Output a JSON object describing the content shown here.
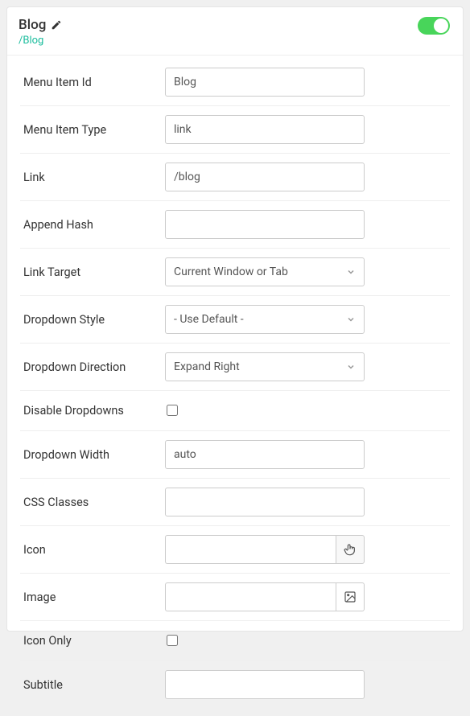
{
  "header": {
    "title": "Blog",
    "path": "/Blog",
    "enabled": true
  },
  "fields": {
    "menu_item_id": {
      "label": "Menu Item Id",
      "value": "Blog"
    },
    "menu_item_type": {
      "label": "Menu Item Type",
      "value": "link"
    },
    "link": {
      "label": "Link",
      "value": "/blog"
    },
    "append_hash": {
      "label": "Append Hash",
      "value": ""
    },
    "link_target": {
      "label": "Link Target",
      "value": "Current Window or Tab"
    },
    "dropdown_style": {
      "label": "Dropdown Style",
      "value": "- Use Default -"
    },
    "dropdown_direction": {
      "label": "Dropdown Direction",
      "value": "Expand Right"
    },
    "disable_dropdowns": {
      "label": "Disable Dropdowns"
    },
    "dropdown_width": {
      "label": "Dropdown Width",
      "value": "auto"
    },
    "css_classes": {
      "label": "CSS Classes",
      "value": ""
    },
    "icon": {
      "label": "Icon",
      "value": ""
    },
    "image": {
      "label": "Image",
      "value": ""
    },
    "icon_only": {
      "label": "Icon Only"
    },
    "subtitle": {
      "label": "Subtitle",
      "value": ""
    }
  }
}
